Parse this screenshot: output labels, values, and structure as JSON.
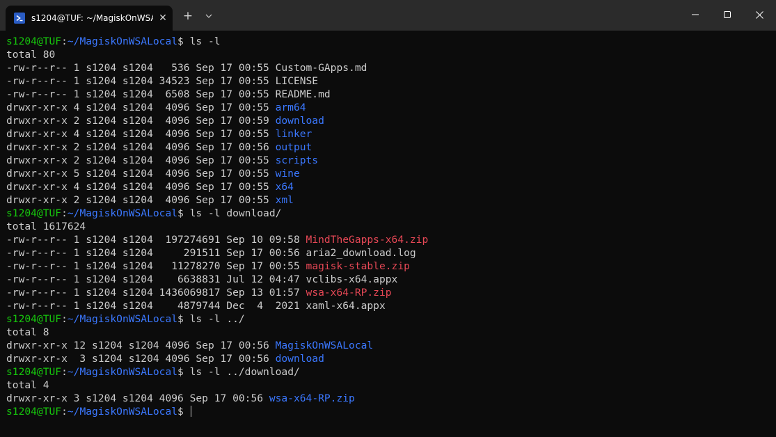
{
  "tab": {
    "title": "s1204@TUF: ~/MagiskOnWSA",
    "close": "✕"
  },
  "toolbar": {
    "new_tab": "+"
  },
  "colors": {
    "user": "#16c60c",
    "dir": "#3b78ff",
    "archive": "#e74856",
    "text": "#cccccc",
    "bg": "#0c0c0c"
  },
  "prompt": {
    "user": "s1204@TUF",
    "sep": ":",
    "path": "~/MagiskOnWSALocal",
    "sym": "$ "
  },
  "lines": [
    {
      "t": "p",
      "cmd": "ls -l"
    },
    {
      "t": "o",
      "text": "total 80"
    },
    {
      "t": "o",
      "text": "-rw-r--r-- 1 s1204 s1204   536 Sep 17 00:55 ",
      "name": "Custom-GApps.md",
      "c": ""
    },
    {
      "t": "o",
      "text": "-rw-r--r-- 1 s1204 s1204 34523 Sep 17 00:55 ",
      "name": "LICENSE",
      "c": ""
    },
    {
      "t": "o",
      "text": "-rw-r--r-- 1 s1204 s1204  6508 Sep 17 00:55 ",
      "name": "README.md",
      "c": ""
    },
    {
      "t": "o",
      "text": "drwxr-xr-x 4 s1204 s1204  4096 Sep 17 00:55 ",
      "name": "arm64",
      "c": "b"
    },
    {
      "t": "o",
      "text": "drwxr-xr-x 2 s1204 s1204  4096 Sep 17 00:59 ",
      "name": "download",
      "c": "b"
    },
    {
      "t": "o",
      "text": "drwxr-xr-x 4 s1204 s1204  4096 Sep 17 00:55 ",
      "name": "linker",
      "c": "b"
    },
    {
      "t": "o",
      "text": "drwxr-xr-x 2 s1204 s1204  4096 Sep 17 00:56 ",
      "name": "output",
      "c": "b"
    },
    {
      "t": "o",
      "text": "drwxr-xr-x 2 s1204 s1204  4096 Sep 17 00:55 ",
      "name": "scripts",
      "c": "b"
    },
    {
      "t": "o",
      "text": "drwxr-xr-x 5 s1204 s1204  4096 Sep 17 00:55 ",
      "name": "wine",
      "c": "b"
    },
    {
      "t": "o",
      "text": "drwxr-xr-x 4 s1204 s1204  4096 Sep 17 00:55 ",
      "name": "x64",
      "c": "b"
    },
    {
      "t": "o",
      "text": "drwxr-xr-x 2 s1204 s1204  4096 Sep 17 00:55 ",
      "name": "xml",
      "c": "b"
    },
    {
      "t": "p",
      "cmd": "ls -l download/"
    },
    {
      "t": "o",
      "text": "total 1617624"
    },
    {
      "t": "o",
      "text": "-rw-r--r-- 1 s1204 s1204  197274691 Sep 10 09:58 ",
      "name": "MindTheGapps-x64.zip",
      "c": "r"
    },
    {
      "t": "o",
      "text": "-rw-r--r-- 1 s1204 s1204     291511 Sep 17 00:56 ",
      "name": "aria2_download.log",
      "c": ""
    },
    {
      "t": "o",
      "text": "-rw-r--r-- 1 s1204 s1204   11278270 Sep 17 00:55 ",
      "name": "magisk-stable.zip",
      "c": "r"
    },
    {
      "t": "o",
      "text": "-rw-r--r-- 1 s1204 s1204    6638831 Jul 12 04:47 ",
      "name": "vclibs-x64.appx",
      "c": ""
    },
    {
      "t": "o",
      "text": "-rw-r--r-- 1 s1204 s1204 1436069817 Sep 13 01:57 ",
      "name": "wsa-x64-RP.zip",
      "c": "r"
    },
    {
      "t": "o",
      "text": "-rw-r--r-- 1 s1204 s1204    4879744 Dec  4  2021 ",
      "name": "xaml-x64.appx",
      "c": ""
    },
    {
      "t": "p",
      "cmd": "ls -l ../"
    },
    {
      "t": "o",
      "text": "total 8"
    },
    {
      "t": "o",
      "text": "drwxr-xr-x 12 s1204 s1204 4096 Sep 17 00:56 ",
      "name": "MagiskOnWSALocal",
      "c": "b"
    },
    {
      "t": "o",
      "text": "drwxr-xr-x  3 s1204 s1204 4096 Sep 17 00:56 ",
      "name": "download",
      "c": "b"
    },
    {
      "t": "p",
      "cmd": "ls -l ../download/"
    },
    {
      "t": "o",
      "text": "total 4"
    },
    {
      "t": "o",
      "text": "drwxr-xr-x 3 s1204 s1204 4096 Sep 17 00:56 ",
      "name": "wsa-x64-RP.zip",
      "c": "b"
    },
    {
      "t": "p",
      "cmd": "",
      "cursor": true
    }
  ]
}
